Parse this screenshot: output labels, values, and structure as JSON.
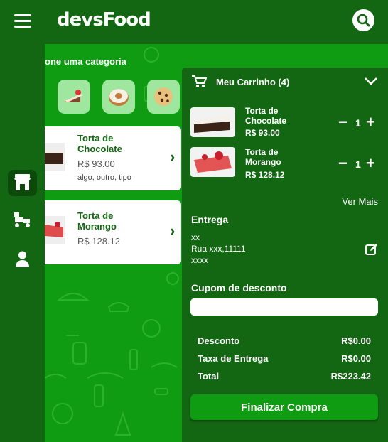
{
  "header": {
    "logo_text": "devsFood",
    "menu_icon": "hamburger-icon",
    "search_icon": "search-icon"
  },
  "sidebar": {
    "items": [
      {
        "name": "store",
        "icon": "store-icon",
        "active": true
      },
      {
        "name": "delivery",
        "icon": "delivery-icon",
        "active": false
      },
      {
        "name": "profile",
        "icon": "user-icon",
        "active": false
      }
    ]
  },
  "main": {
    "category_title": "one uma categoria",
    "categories": [
      {
        "icon": "cake-icon"
      },
      {
        "icon": "donut-icon"
      },
      {
        "icon": "cookie-icon"
      }
    ],
    "products": [
      {
        "name": "Torta de Chocolate",
        "price": "R$ 93.00",
        "desc": "algo, outro, tipo"
      },
      {
        "name": "Torta de Morango",
        "price": "R$ 128.12",
        "desc": ""
      }
    ]
  },
  "cart": {
    "title": "Meu Carrinho",
    "count": "(4)",
    "items": [
      {
        "name": "Torta de Chocolate",
        "price": "R$ 93.00",
        "qty": "1"
      },
      {
        "name": "Torta de Morango",
        "price": "R$ 128.12",
        "qty": "1"
      }
    ],
    "ver_mais": "Ver Mais",
    "delivery_title": "Entrega",
    "address": {
      "line1": "xx",
      "line2": "Rua xxx,11111",
      "line3": "xxxx"
    },
    "coupon_title": "Cupom de desconto",
    "coupon_value": "",
    "discount_label": "Desconto",
    "discount_value": "R$0.00",
    "fee_label": "Taxa de Entrega",
    "fee_value": "R$0.00",
    "total_label": "Total",
    "total_value": "R$223.42",
    "checkout_label": "Finalizar Compra"
  },
  "colors": {
    "dark_green": "#136713",
    "bright_green": "#0f9b12",
    "light_green": "#9fe79f"
  }
}
